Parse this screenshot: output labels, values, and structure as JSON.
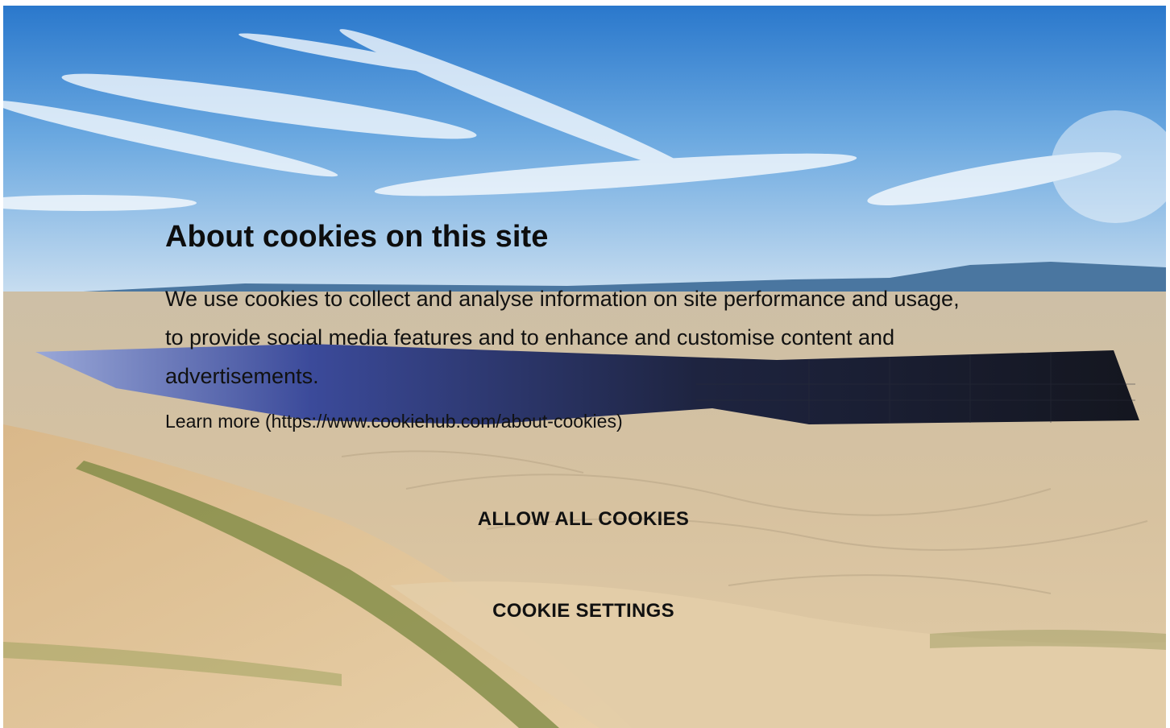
{
  "background": {
    "icon": "landscape-solar-farm-photo",
    "colors": {
      "sky_top": "#2f7fd0",
      "sky_low": "#bcd9ee",
      "mountains": "#3f6f9a",
      "panels": "#1d2238",
      "sand": "#d9c4a1",
      "grass": "#7c8a3c"
    }
  },
  "cookie_banner": {
    "title": "About cookies on this site",
    "body": "We use cookies to collect and analyse information on site performance and usage, to provide social media features and to enhance and customise content and advertisements.",
    "learn_more": "Learn more (https://www.cookiehub.com/about-cookies)",
    "allow_all_label": "ALLOW ALL COOKIES",
    "settings_label": "COOKIE SETTINGS"
  }
}
